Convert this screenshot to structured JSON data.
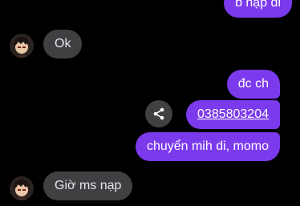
{
  "conversation": {
    "messages": [
      {
        "sender": "me",
        "text": "b nạp đi"
      },
      {
        "sender": "them",
        "text": "Ok"
      },
      {
        "sender": "me",
        "text": "đc ch"
      },
      {
        "sender": "me",
        "text": "0385803204",
        "is_phone_link": true
      },
      {
        "sender": "me",
        "text": "chuyển mih di, momo"
      },
      {
        "sender": "them",
        "text": "Giờ ms nạp"
      }
    ]
  },
  "colors": {
    "background": "#000000",
    "sent_bubble": "#7c3aed",
    "received_bubble": "#3e4042"
  },
  "icons": {
    "share": "share-icon",
    "avatar": "contact-avatar"
  }
}
